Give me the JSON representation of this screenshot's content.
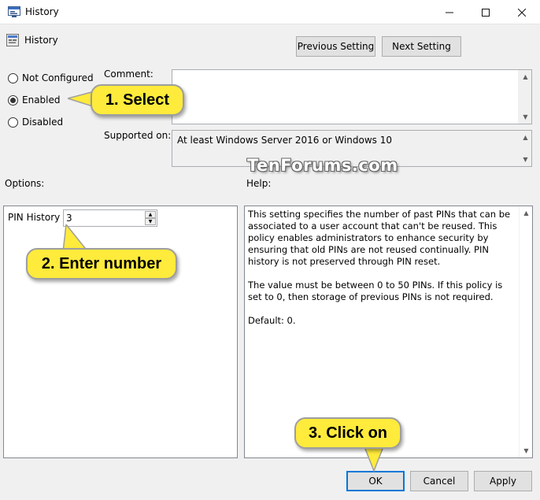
{
  "window": {
    "title": "History"
  },
  "policy": {
    "name": "History"
  },
  "nav": {
    "previous_setting": "Previous Setting",
    "next_setting": "Next Setting"
  },
  "state": {
    "options": [
      {
        "label": "Not Configured",
        "selected": false
      },
      {
        "label": "Enabled",
        "selected": true
      },
      {
        "label": "Disabled",
        "selected": false
      }
    ]
  },
  "comment": {
    "label": "Comment:",
    "value": ""
  },
  "supported": {
    "label": "Supported on:",
    "value": "At least Windows Server 2016 or Windows 10"
  },
  "options_section": {
    "label": "Options:",
    "pin_history_label": "PIN History",
    "pin_history_value": "3"
  },
  "help": {
    "label": "Help:",
    "text": "This setting specifies the number of past PINs that can be associated to a user account that can't be reused. This policy enables administrators to enhance security by ensuring that old PINs are not reused continually. PIN history is not preserved through PIN reset.\n\nThe value must be between 0 to 50 PINs. If this policy is set to 0, then storage of previous PINs is not required.\n\nDefault: 0."
  },
  "buttons": {
    "ok": "OK",
    "cancel": "Cancel",
    "apply": "Apply"
  },
  "annotations": {
    "step1": "1. Select",
    "step2": "2. Enter number",
    "step3": "3. Click on"
  },
  "watermark": "TenForums.com",
  "icons": {
    "window": "policy-window-icon",
    "policy": "policy-setting-icon",
    "minimize": "minimize-icon",
    "maximize": "maximize-icon",
    "close": "close-icon"
  },
  "colors": {
    "accent": "#0078d7",
    "callout": "#ffeb3b"
  }
}
